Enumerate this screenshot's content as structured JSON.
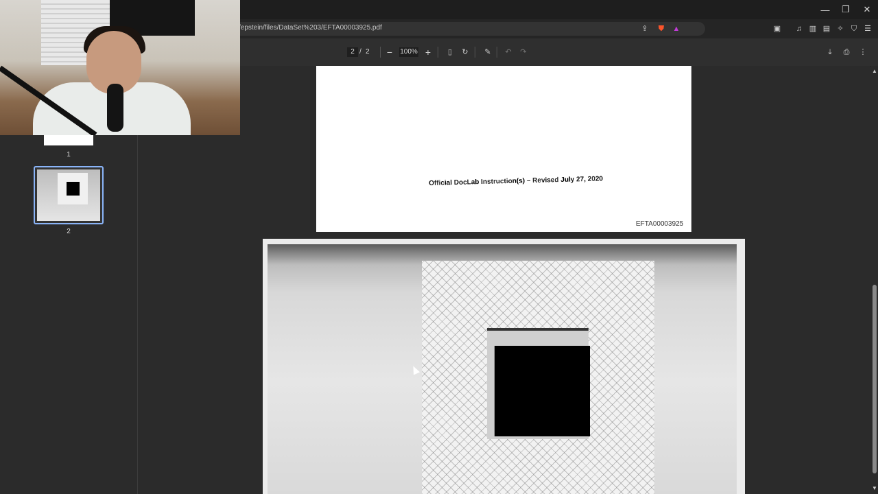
{
  "browser": {
    "url": "/epstein/files/DataSet%203/EFTA00003925.pdf",
    "window_controls": {
      "minimize": "—",
      "restore": "❐",
      "close": "✕"
    },
    "icons": [
      "share-icon",
      "brave-shield-icon",
      "rewards-icon",
      "screenshot-icon",
      "media-icon",
      "sidebar-icon",
      "wallet-icon",
      "leo-ai-icon",
      "vpn-icon",
      "menu-icon"
    ]
  },
  "pdf_toolbar": {
    "current_page": "2",
    "separator": "/",
    "total_pages": "2",
    "zoom": "100%",
    "zoom_out": "−",
    "zoom_in": "+",
    "icons": [
      "fit-page-icon",
      "rotate-icon",
      "annotate-icon",
      "undo-icon",
      "redo-icon",
      "download-icon",
      "print-icon",
      "more-icon"
    ]
  },
  "sidebar": {
    "thumbnails": [
      {
        "label": "1"
      },
      {
        "label": "2"
      }
    ]
  },
  "document": {
    "page1_text": "Official DocLab Instruction(s) – Revised July 27, 2020",
    "page1_id": "EFTA00003925"
  },
  "colors": {
    "accent": "#8ab4f8",
    "background": "#2b2b2b"
  }
}
